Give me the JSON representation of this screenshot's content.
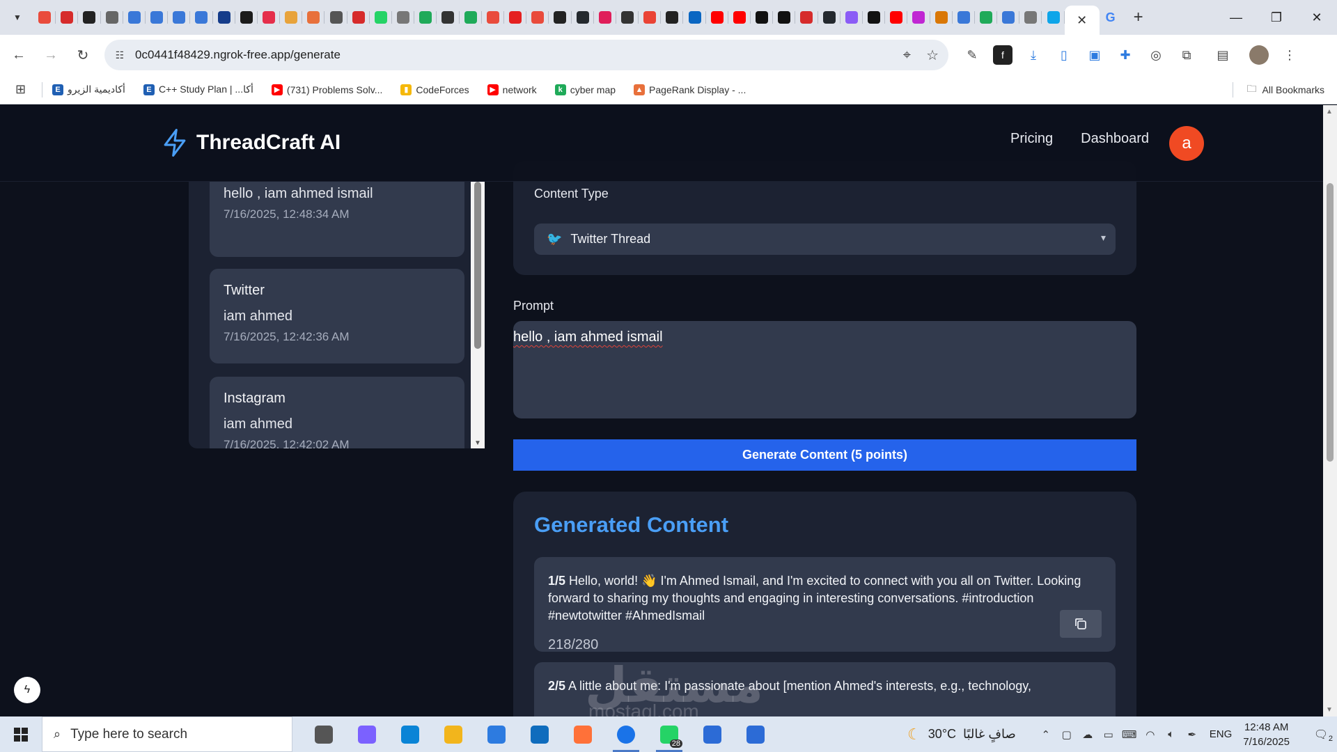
{
  "browser": {
    "tab_favicon_colors": [
      "#e94b3c",
      "#d62b2b",
      "#222222",
      "#666666",
      "#3a78d8",
      "#3a78d8",
      "#3a78d8",
      "#3a78d8",
      "#153c8a",
      "#1b1b1b",
      "#e52e4b",
      "#e8a33b",
      "#e8703b",
      "#555555",
      "#d62b2b",
      "#25d366",
      "#777777",
      "#1faa59",
      "#333333",
      "#1faa59",
      "#e94b3c",
      "#e52020",
      "#e94b3c",
      "#222222",
      "#24292e",
      "#e01e5a",
      "#333333",
      "#ea4335",
      "#222222",
      "#0a66c2",
      "#ff0000",
      "#ff0000",
      "#111111",
      "#111111",
      "#d62b2b",
      "#24292e",
      "#8b5cf6",
      "#111111",
      "#ff0000",
      "#c026d3",
      "#d97706",
      "#3a78d8",
      "#1faa59",
      "#3a78d8",
      "#777777",
      "#0ea5e9"
    ],
    "active_tab_close": "✕",
    "new_tab": "+",
    "url": "0c0441f48429.ngrok-free.app/generate",
    "bookmarks": [
      {
        "label": "أكاديمية الزيرو",
        "icon": "E",
        "color": "#1f5fb3"
      },
      {
        "label": "C++ Study Plan | ...أكا",
        "icon": "E",
        "color": "#1f5fb3"
      },
      {
        "label": "(731) Problems Solv...",
        "icon": "▶",
        "color": "#ff0000"
      },
      {
        "label": "CodeForces",
        "icon": "▮",
        "color": "#f5b80b"
      },
      {
        "label": "network",
        "icon": "▶",
        "color": "#ff0000"
      },
      {
        "label": "cyber map",
        "icon": "k",
        "color": "#1faa59"
      },
      {
        "label": "PageRank Display - ...",
        "icon": "▲",
        "color": "#e8703b"
      }
    ],
    "all_bookmarks": "All Bookmarks"
  },
  "app": {
    "brand": "ThreadCraft AI",
    "nav": {
      "pricing": "Pricing",
      "dashboard": "Dashboard"
    },
    "avatar_letter": "a",
    "history": [
      {
        "platform": "",
        "snippet": "hello , iam ahmed ismail",
        "stamp": "7/16/2025, 12:48:34 AM"
      },
      {
        "platform": "Twitter",
        "snippet": "iam ahmed",
        "stamp": "7/16/2025, 12:42:36 AM"
      },
      {
        "platform": "Instagram",
        "snippet": "iam ahmed",
        "stamp": "7/16/2025, 12:42:02 AM"
      }
    ],
    "content_type": {
      "label": "Content Type",
      "value": "Twitter Thread"
    },
    "prompt": {
      "label": "Prompt",
      "value": "hello , iam ahmed ismail"
    },
    "generate_label": "Generate Content (5 points)",
    "output": {
      "title": "Generated Content",
      "tweets": [
        {
          "num": "1/5",
          "text": " Hello, world! 👋 I'm Ahmed Ismail, and I'm excited to connect with you all on Twitter. Looking forward to sharing my thoughts and engaging in interesting conversations. #introduction #newtotwitter #AhmedIsmail",
          "count": "218/280"
        },
        {
          "num": "2/5",
          "text": " A little about me: I'm passionate about [mention Ahmed's interests, e.g., technology,",
          "count": ""
        }
      ]
    }
  },
  "watermark": {
    "main": "مستقل",
    "sub": "mostaql.com"
  },
  "taskbar": {
    "search_placeholder": "Type here to search",
    "icon_colors": [
      "#555555",
      "#7b61ff",
      "#0a84d6",
      "#f2b51c",
      "#2d7be0",
      "#0f6cbd",
      "#ff7139",
      "#1a73e8",
      "#25d366",
      "#2c6bd6",
      "#2c6bd6"
    ],
    "whatsapp_badge": "28",
    "weather_temp": "30°C",
    "weather_text": "صافٍ غالبًا",
    "lang": "ENG",
    "time": "12:48 AM",
    "date": "7/16/2025",
    "notif_count": "2"
  }
}
